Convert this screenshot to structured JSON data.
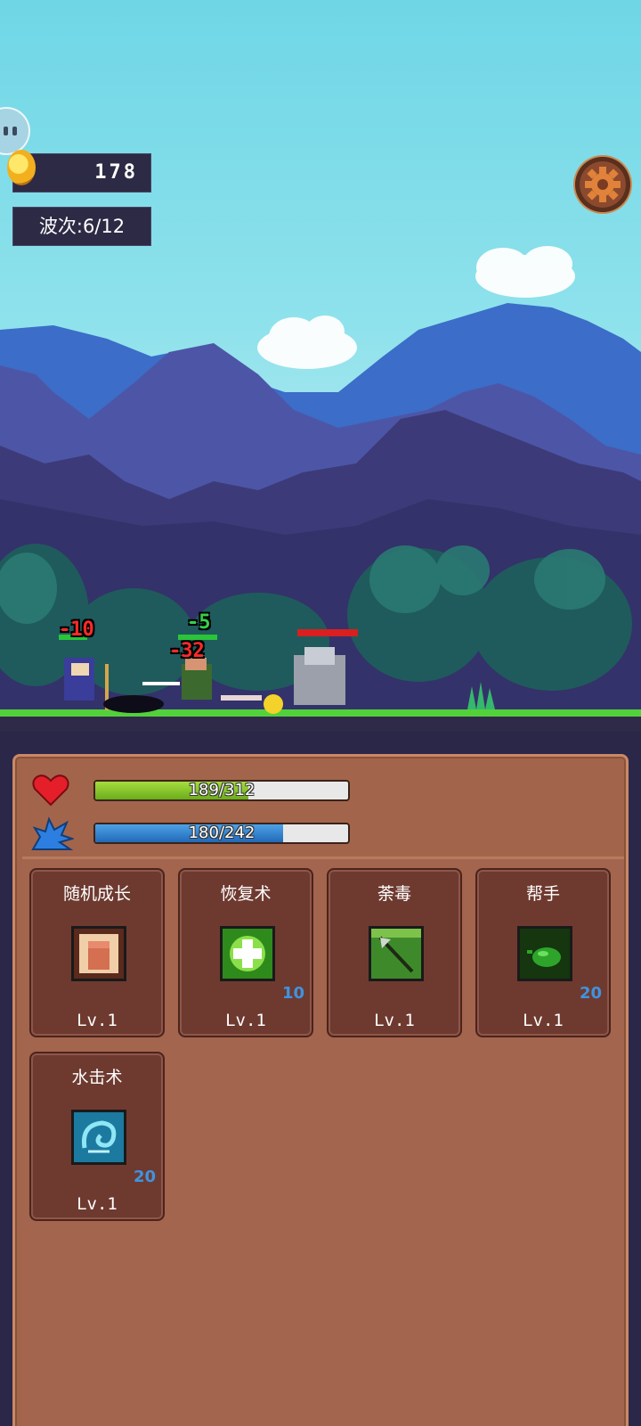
{
  "hud": {
    "gold": "178",
    "wave_label": "波次:6/12"
  },
  "combat": {
    "damage_numbers": [
      "-10",
      "-5",
      "-32"
    ]
  },
  "stats": {
    "hp": {
      "current": 189,
      "max": 312,
      "text": "189/312",
      "fraction": 0.606
    },
    "mp": {
      "current": 180,
      "max": 242,
      "text": "180/242",
      "fraction": 0.744
    }
  },
  "skills": [
    {
      "name": "随机成长",
      "level": "Lv.1",
      "cost": "",
      "icon": "fist-icon"
    },
    {
      "name": "恢复术",
      "level": "Lv.1",
      "cost": "10",
      "icon": "heal-cross-icon"
    },
    {
      "name": "荼毒",
      "level": "Lv.1",
      "cost": "",
      "icon": "poison-arrow-icon"
    },
    {
      "name": "帮手",
      "level": "Lv.1",
      "cost": "20",
      "icon": "slime-icon"
    },
    {
      "name": "水击术",
      "level": "Lv.1",
      "cost": "20",
      "icon": "water-wave-icon"
    }
  ],
  "colors": {
    "hp": "#6bad1c",
    "mp": "#2269b8",
    "panel": "#a2654c",
    "card": "#6e3a30",
    "cost_text": "#3f93e0"
  }
}
